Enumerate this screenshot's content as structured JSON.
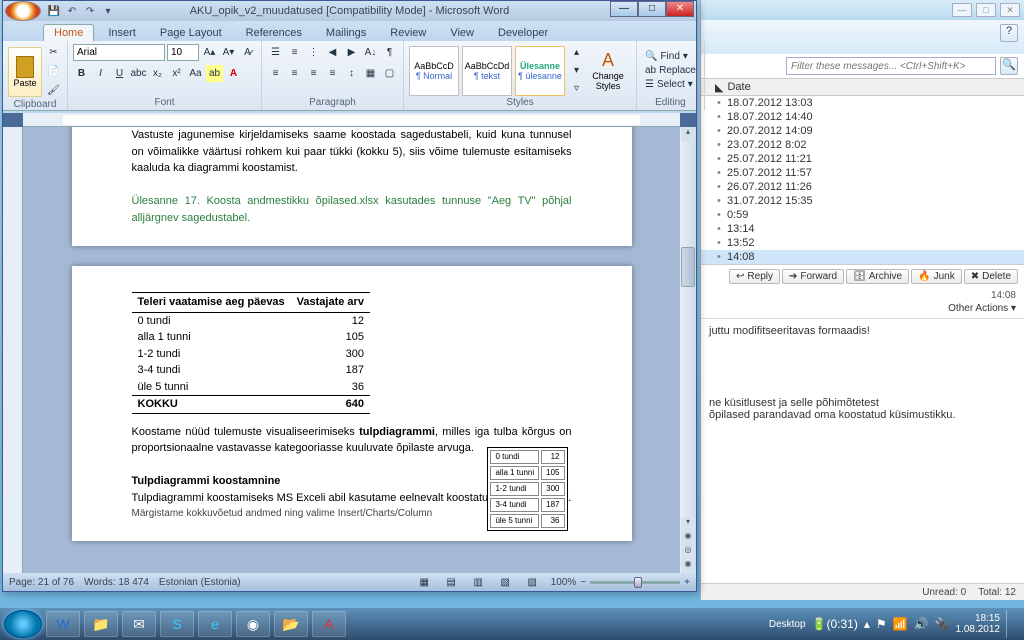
{
  "word": {
    "title": "AKU_opik_v2_muudatused [Compatibility Mode] - Microsoft Word",
    "tabs": [
      "Home",
      "Insert",
      "Page Layout",
      "References",
      "Mailings",
      "Review",
      "View",
      "Developer"
    ],
    "active_tab": 0,
    "ribbon": {
      "clipboard": {
        "label": "Clipboard",
        "paste": "Paste"
      },
      "font": {
        "label": "Font",
        "family": "Arial",
        "size": "10"
      },
      "paragraph": {
        "label": "Paragraph"
      },
      "styles": {
        "label": "Styles",
        "s1": "AaBbCcD",
        "s1n": "¶ Normal",
        "s2": "AaBbCcDd",
        "s2n": "¶ tekst",
        "s3": "Ülesanne",
        "s3n": "¶ ülesanne",
        "change": "Change Styles"
      },
      "editing": {
        "label": "Editing",
        "find": "Find",
        "replace": "Replace",
        "select": "Select"
      }
    },
    "doc": {
      "p1": "Vastuste jagunemise kirjeldamiseks saame koostada sagedustabeli, kuid kuna tunnusel on võimalikke väärtusi rohkem kui paar tükki (kokku 5), siis võime tulemuste esitamiseks kaaluda ka diagrammi koostamist.",
      "p2": "Ülesanne 17.   Koosta andmestikku õpilased.xlsx kasutades tunnuse \"Aeg TV\" põhjal alljärgnev sagedustabel.",
      "p3": "Koostame nüüd tulemuste visualiseerimiseks ",
      "p3b": "tulpdiagrammi",
      "p3c": ", milles iga tulba kõrgus on proportsionaalne vastavasse kategooriasse kuuluvate õpilaste arvuga.",
      "p4h": "Tulpdiagrammi koostamnine",
      "p4": "Tulpdiagrammi koostamiseks MS Exceli abil kasutame eelnevalt koostatud sagedustabelit.",
      "p5": "Märgistame kokkuvõetud andmed ning valime Insert/Charts/Column"
    },
    "status": {
      "page": "Page: 21 of 76",
      "words": "Words: 18 474",
      "lang": "Estonian (Estonia)",
      "zoom": "100%"
    }
  },
  "chart_data": {
    "type": "table",
    "title_col1": "Teleri vaatamise aeg päevas",
    "title_col2": "Vastajate arv",
    "categories": [
      "0 tundi",
      "alla 1 tunni",
      "1-2 tundi",
      "3-4 tundi",
      "üle 5 tunni"
    ],
    "values": [
      12,
      105,
      300,
      187,
      36
    ],
    "total_label": "KOKKU",
    "total": 640
  },
  "mail": {
    "search_placeholder": "Filter these messages... <Ctrl+Shift+K>",
    "date_header": "Date",
    "items": [
      "18.07.2012 13:03",
      "18.07.2012 14:40",
      "20.07.2012 14:09",
      "23.07.2012 8:02",
      "25.07.2012 11:21",
      "25.07.2012 11:57",
      "26.07.2012 11:26",
      "31.07.2012 15:35",
      "0:59",
      "13:14",
      "13:52",
      "14:08"
    ],
    "actions": {
      "reply": "Reply",
      "forward": "Forward",
      "archive": "Archive",
      "junk": "Junk",
      "delete": "Delete"
    },
    "timestamp": "14:08",
    "other": "Other Actions",
    "body_l1": "juttu modifitseeritavas formaadis!",
    "body_l2": "ne küsitlusest ja selle põhimõtetest",
    "body_l3": "õpilased parandavad oma koostatud küsimustikku.",
    "unread": "Unread: 0",
    "total": "Total: 12"
  },
  "tray": {
    "desktop": "Desktop",
    "batt": "(0:31)",
    "time": "18:15",
    "date": "1.08.2012"
  }
}
